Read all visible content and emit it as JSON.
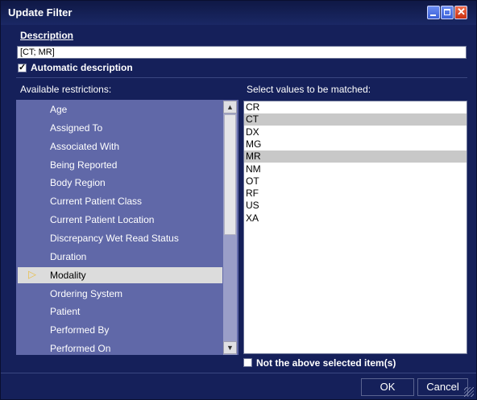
{
  "window": {
    "title": "Update Filter"
  },
  "description": {
    "label": "Description",
    "value": "[CT; MR]",
    "auto_label": "Automatic description",
    "auto_checked": true
  },
  "restrictions": {
    "label": "Available restrictions:",
    "items": [
      "Age",
      "Assigned To",
      "Associated With",
      "Being Reported",
      "Body Region",
      "Current Patient Class",
      "Current Patient Location",
      "Discrepancy Wet Read Status",
      "Duration",
      "Modality",
      "Ordering System",
      "Patient",
      "Performed By",
      "Performed On"
    ],
    "selected": "Modality"
  },
  "values": {
    "label": "Select values to be matched:",
    "items": [
      "CR",
      "CT",
      "DX",
      "MG",
      "MR",
      "NM",
      "OT",
      "RF",
      "US",
      "XA"
    ],
    "selected": [
      "CT",
      "MR"
    ],
    "negate_label": "Not the above selected item(s)",
    "negate_checked": false
  },
  "buttons": {
    "ok": "OK",
    "cancel": "Cancel"
  },
  "colors": {
    "background": "#15205a",
    "panel": "#6068a8",
    "selection": "#dcdcdc"
  }
}
